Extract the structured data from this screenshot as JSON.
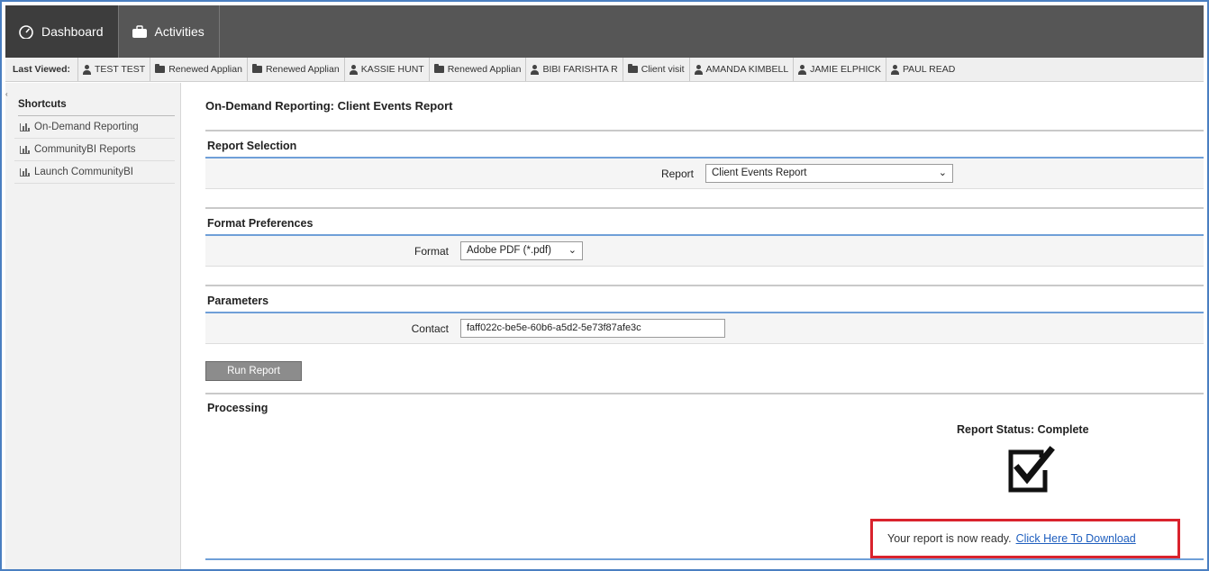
{
  "topnav": {
    "dashboard_label": "Dashboard",
    "activities_label": "Activities"
  },
  "last_viewed": {
    "label": "Last Viewed:",
    "items": [
      {
        "type": "user",
        "label": "TEST TEST"
      },
      {
        "type": "folder",
        "label": "Renewed Applian"
      },
      {
        "type": "folder",
        "label": "Renewed Applian"
      },
      {
        "type": "user",
        "label": "KASSIE HUNT"
      },
      {
        "type": "folder",
        "label": "Renewed Applian"
      },
      {
        "type": "user",
        "label": "BIBI FARISHTA R"
      },
      {
        "type": "folder",
        "label": "Client visit"
      },
      {
        "type": "user",
        "label": "AMANDA KIMBELL"
      },
      {
        "type": "user",
        "label": "JAMIE ELPHICK"
      },
      {
        "type": "user",
        "label": "PAUL READ"
      }
    ]
  },
  "sidebar": {
    "title": "Shortcuts",
    "items": [
      {
        "label": "On-Demand Reporting"
      },
      {
        "label": "CommunityBI Reports"
      },
      {
        "label": "Launch CommunityBI"
      }
    ]
  },
  "main": {
    "page_title": "On-Demand Reporting: Client Events Report",
    "report_selection": {
      "heading": "Report Selection",
      "report_label": "Report",
      "report_value": "Client Events Report"
    },
    "format_preferences": {
      "heading": "Format Preferences",
      "format_label": "Format",
      "format_value": "Adobe PDF (*.pdf)"
    },
    "parameters": {
      "heading": "Parameters",
      "contact_label": "Contact",
      "contact_value": "faff022c-be5e-60b6-a5d2-5e73f87afe3c"
    },
    "run_button": "Run Report",
    "processing": {
      "heading": "Processing",
      "status": "Report Status: Complete",
      "ready_text": "Your report is now ready.",
      "download_link": "Click Here To Download"
    }
  },
  "colors": {
    "nav_bg": "#565656",
    "accent_blue": "#6f9fd8",
    "highlight_red": "#d9232d",
    "link": "#1f5fbf"
  }
}
